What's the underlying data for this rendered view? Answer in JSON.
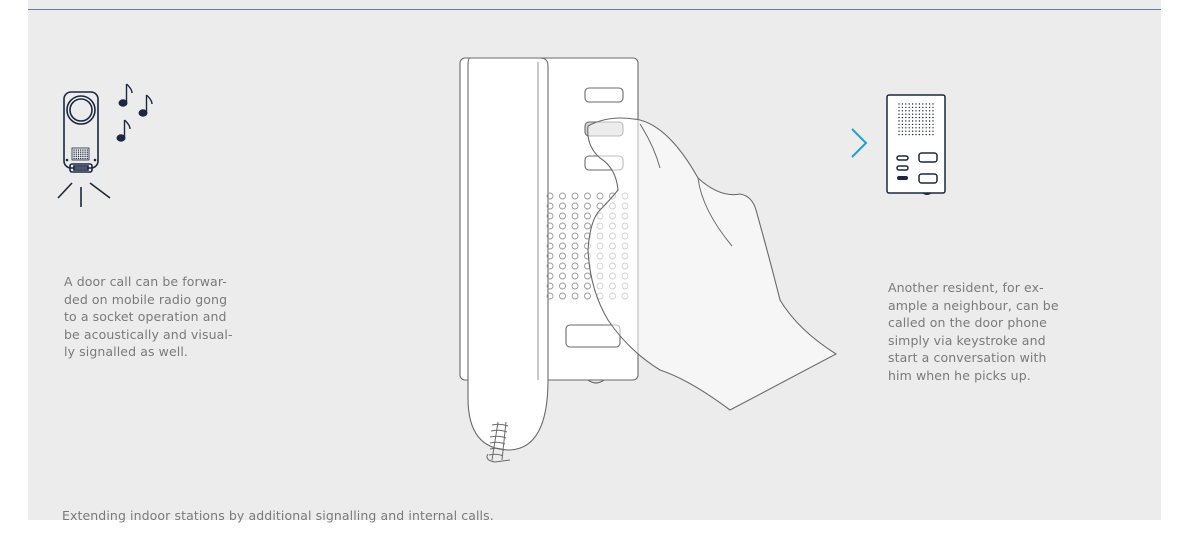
{
  "left_description": "A door call can be forwar-\nded on mobile radio gong\nto a socket operation and\nbe acoustically and visual-\nly signalled as well.",
  "right_description": "Another resident, for ex-\nample a neighbour, can be\ncalled on the door phone\nsimply via keystroke and\nstart a conversation with\nhim when he picks up.",
  "caption": "Extending indoor stations by additional signalling and internal calls.",
  "colors": {
    "panel_background": "#ececec",
    "top_line": "#6b7d9a",
    "text": "#7a7a7a",
    "accent_chevron": "#1ea0d2",
    "icon_stroke": "#1c2740"
  },
  "icons": [
    "radio-gong-icon",
    "music-notes-icon",
    "light-rays-icon",
    "indoor-phone-handset-icon",
    "hand-icon",
    "chevron-right-icon",
    "indoor-station-icon"
  ]
}
